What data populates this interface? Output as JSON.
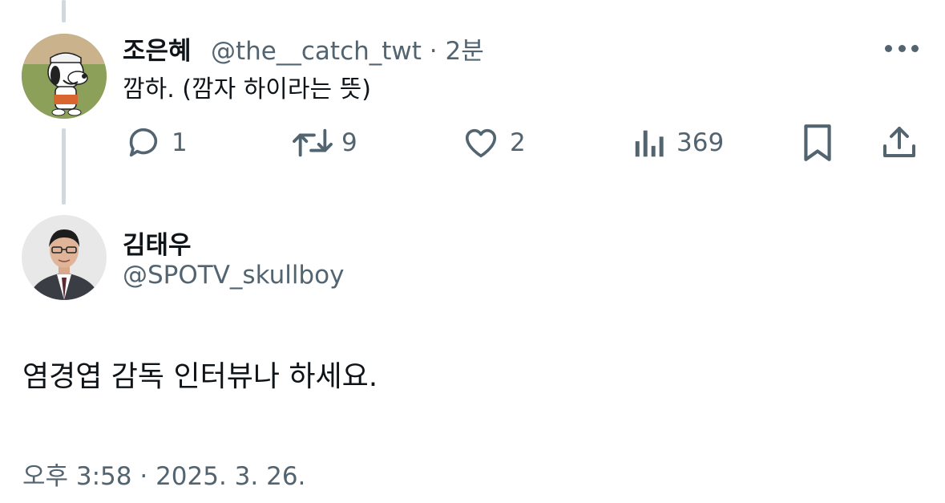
{
  "reply": {
    "display_name": "조은혜",
    "handle": "@the__catch_twt",
    "separator": "·",
    "time": "2분",
    "text": "깜하. (깜자 하이라는 뜻)",
    "actions": {
      "reply_count": "1",
      "retweet_count": "9",
      "like_count": "2",
      "views_count": "369"
    }
  },
  "main_tweet": {
    "display_name": "김태우",
    "handle": "@SPOTV_skullboy",
    "text": "염경엽 감독 인터뷰나 하세요.",
    "timestamp": "오후 3:58 · 2025. 3. 26."
  },
  "colors": {
    "text": "#0f1419",
    "secondary": "#536471",
    "thread_line": "#cfd9de"
  }
}
